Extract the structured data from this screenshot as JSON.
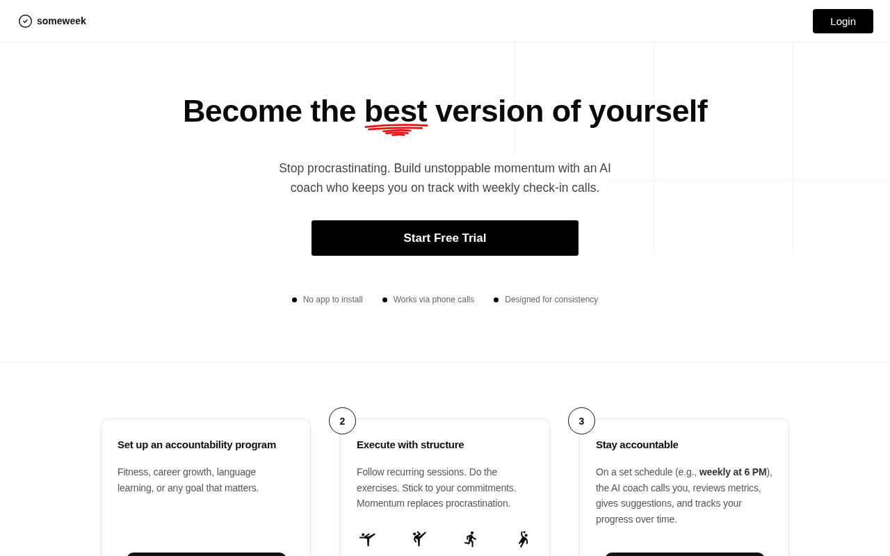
{
  "header": {
    "brand": "someweek",
    "login": "Login"
  },
  "hero": {
    "title": {
      "before": "Become the ",
      "highlight": "best",
      "after": " version of yourself"
    },
    "subtitle": "Stop procrastinating. Build unstoppable momentum with an AI coach who keeps you on track with weekly check-in calls.",
    "cta": "Start Free Trial",
    "features": [
      "No app to install",
      "Works via phone calls",
      "Designed for consistency"
    ]
  },
  "steps": [
    {
      "kind": "button",
      "title": "Set up an accountability program",
      "text": "Fitness, career growth, language learning, or any goal that matters."
    },
    {
      "kind": "icons",
      "number": "2",
      "title": "Execute with structure",
      "text": "Follow recurring sessions. Do the exercises. Stick to your commitments. Momentum replaces procrastination."
    },
    {
      "kind": "button",
      "number": "3",
      "title": "Stay accountable",
      "text": "On a set schedule (e.g., **weekly at 6 PM**), the AI coach calls you, reviews metrics, gives suggestions, and tracks your progress over time."
    }
  ]
}
